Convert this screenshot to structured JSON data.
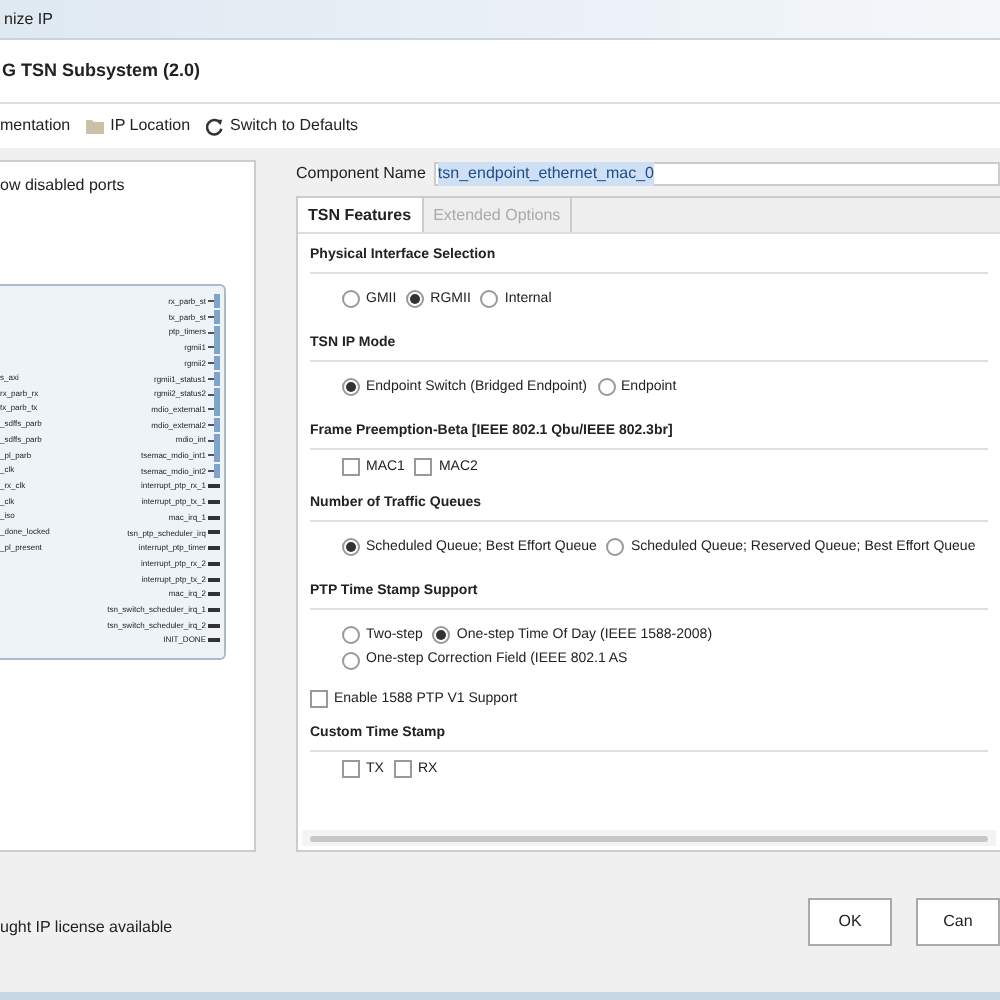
{
  "window": {
    "title": "nize IP"
  },
  "heading": "G TSN Subsystem (2.0)",
  "toolbar": [
    {
      "kind": "doc",
      "label": "mentation"
    },
    {
      "kind": "folder",
      "label": "IP Location"
    },
    {
      "kind": "refresh",
      "label": "Switch to Defaults"
    }
  ],
  "left_panel": {
    "show_disabled_ports": "ow disabled ports",
    "left_ports": [
      "s_axi",
      "rx_parb_rx",
      "tx_parb_tx",
      "_sdffs_parb",
      "_sdffs_parb",
      "_pl_parb",
      "_clk",
      "_rx_clk",
      "_clk",
      "_iso",
      "_done_locked",
      "_pl_present"
    ],
    "right_ports": [
      {
        "name": "rx_parb_st",
        "kind": "bus"
      },
      {
        "name": "tx_parb_st",
        "kind": "bus"
      },
      {
        "name": "ptp_timers",
        "kind": "bus"
      },
      {
        "name": "rgmii1",
        "kind": "bus"
      },
      {
        "name": "rgmii2",
        "kind": "bus"
      },
      {
        "name": "rgmii1_status1",
        "kind": "bus"
      },
      {
        "name": "rgmii2_status2",
        "kind": "bus"
      },
      {
        "name": "mdio_external1",
        "kind": "bus"
      },
      {
        "name": "mdio_external2",
        "kind": "bus"
      },
      {
        "name": "mdio_int",
        "kind": "bus"
      },
      {
        "name": "tsemac_mdio_int1",
        "kind": "bus"
      },
      {
        "name": "tsemac_mdio_int2",
        "kind": "bus"
      },
      {
        "name": "interrupt_ptp_rx_1",
        "kind": "wire"
      },
      {
        "name": "interrupt_ptp_tx_1",
        "kind": "wire"
      },
      {
        "name": "mac_irq_1",
        "kind": "wire"
      },
      {
        "name": "tsn_ptp_scheduler_irq",
        "kind": "wire"
      },
      {
        "name": "interrupt_ptp_timer",
        "kind": "wire"
      },
      {
        "name": "interrupt_ptp_rx_2",
        "kind": "wire"
      },
      {
        "name": "interrupt_ptp_tx_2",
        "kind": "wire"
      },
      {
        "name": "mac_irq_2",
        "kind": "wire"
      },
      {
        "name": "tsn_switch_scheduler_irq_1",
        "kind": "wire"
      },
      {
        "name": "tsn_switch_scheduler_irq_2",
        "kind": "wire"
      },
      {
        "name": "INIT_DONE",
        "kind": "wire"
      }
    ]
  },
  "component_name": {
    "label": "Component Name",
    "value": "tsn_endpoint_ethernet_mac_0"
  },
  "tabs": [
    {
      "label": "TSN Features",
      "selected": true
    },
    {
      "label": "Extended Options",
      "selected": false
    }
  ],
  "sections": [
    {
      "title": "Physical Interface Selection",
      "rows": [
        {
          "kind": "indented",
          "items": [
            {
              "kind": "radio",
              "label": "GMII",
              "checked": false
            },
            {
              "kind": "radio",
              "label": "RGMII",
              "checked": true
            },
            {
              "kind": "radio",
              "label": "Internal",
              "checked": false
            }
          ]
        }
      ]
    },
    {
      "title": "TSN IP Mode",
      "rows": [
        {
          "kind": "indented",
          "items": [
            {
              "kind": "radio",
              "label": "Endpoint Switch (Bridged Endpoint)",
              "checked": true
            },
            {
              "kind": "radio",
              "label": "Endpoint",
              "checked": false
            }
          ]
        }
      ]
    },
    {
      "title": "Frame Preemption-Beta [IEEE 802.1 Qbu/IEEE 802.3br]",
      "rows": [
        {
          "kind": "compact",
          "items": [
            {
              "kind": "checkbox",
              "label": "MAC1",
              "checked": false
            },
            {
              "kind": "checkbox",
              "label": "MAC2",
              "checked": false
            }
          ]
        }
      ]
    },
    {
      "title": "Number of Traffic Queues",
      "rows": [
        {
          "kind": "indented",
          "items": [
            {
              "kind": "radio",
              "label": "Scheduled Queue; Best Effort Queue",
              "checked": true
            },
            {
              "kind": "radio",
              "label": "Scheduled Queue; Reserved Queue; Best Effort Queue",
              "checked": false
            }
          ]
        }
      ]
    },
    {
      "title": "PTP Time Stamp Support",
      "rows": [
        {
          "kind": "indented",
          "items": [
            {
              "kind": "radio",
              "label": "Two-step",
              "checked": false
            },
            {
              "kind": "radio",
              "label": "One-step Time Of Day (IEEE 1588-2008)",
              "checked": true
            },
            {
              "kind": "radio",
              "label": "One-step Correction Field (IEEE 802.1 AS",
              "checked": false
            }
          ]
        },
        {
          "kind": "flush",
          "items": [
            {
              "kind": "checkbox",
              "label": "Enable 1588 PTP V1 Support",
              "checked": false
            }
          ]
        }
      ]
    },
    {
      "title": "Custom Time Stamp",
      "rows": [
        {
          "kind": "compact",
          "items": [
            {
              "kind": "checkbox",
              "label": "TX",
              "checked": false
            },
            {
              "kind": "checkbox",
              "label": "RX",
              "checked": false
            }
          ]
        }
      ]
    }
  ],
  "status": "ught IP license available",
  "buttons": [
    "OK",
    "Can"
  ]
}
